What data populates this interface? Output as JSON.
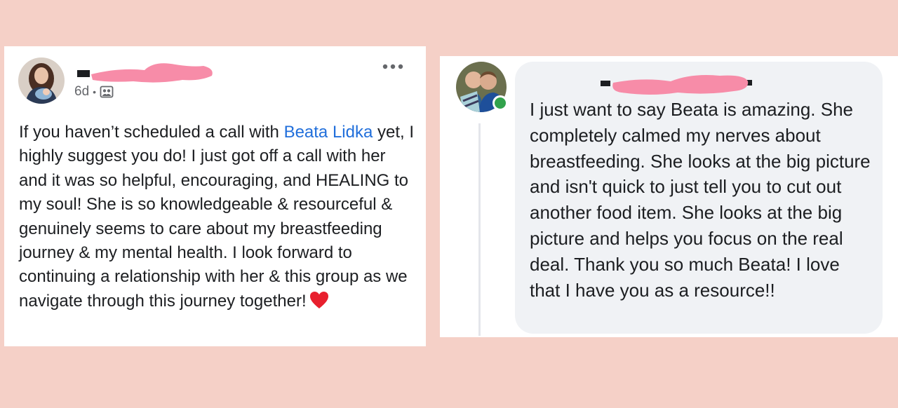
{
  "post": {
    "timestamp": "6d",
    "separator": "•",
    "audience_icon": "group-icon",
    "text_before_mention": "If you haven’t scheduled a call with ",
    "mention": "Beata Lidka",
    "text_after_mention": " yet, I highly suggest you do! I just got off a call with her and it was so helpful, encouraging, and HEALING to my soul! She is so knowledgeable & resourceful & genuinely seems to care about my breastfeeding journey & my mental health. I look forward to continuing a relationship with her & this group as we navigate through this journey together!",
    "emoji": "heart-emoji",
    "more_icon": "more-dots-icon"
  },
  "comment": {
    "text": "I just want to say Beata is amazing. She completely calmed my nerves about breastfeeding. She looks at the big picture and isn't quick to just tell you to cut out another food item. She looks at the big picture and helps you focus on the real deal. Thank you so much Beata! I love that I have you as a resource!!"
  },
  "colors": {
    "page_background": "#f5d0c7",
    "redaction": "#f78ca8",
    "mention_link": "#216fdb",
    "online_status": "#31a24c",
    "comment_bubble": "#f0f2f5"
  }
}
